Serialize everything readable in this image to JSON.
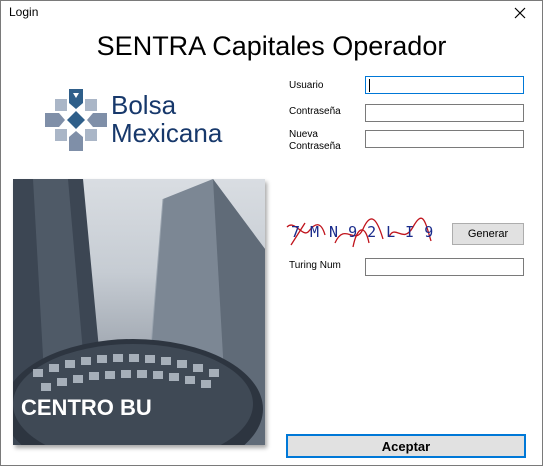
{
  "window": {
    "title": "Login"
  },
  "heading": "SENTRA Capitales Operador",
  "logo": {
    "line1": "Bolsa",
    "line2": "Mexicana"
  },
  "photo": {
    "sign_text": "CENTRO BU"
  },
  "form": {
    "usuario_label": "Usuario",
    "usuario_value": "",
    "contrasena_label": "Contraseña",
    "contrasena_value": "",
    "nueva_label_1": "Nueva",
    "nueva_label_2": "Contraseña",
    "nueva_value": "",
    "captcha_text": "7MN92LI9",
    "generar_label": "Generar",
    "turing_label": "Turing Num",
    "turing_value": "",
    "aceptar_label": "Aceptar"
  },
  "colors": {
    "logo_blue": "#17386b",
    "focus_blue": "#0078d7",
    "captcha_red": "#c0141c"
  }
}
